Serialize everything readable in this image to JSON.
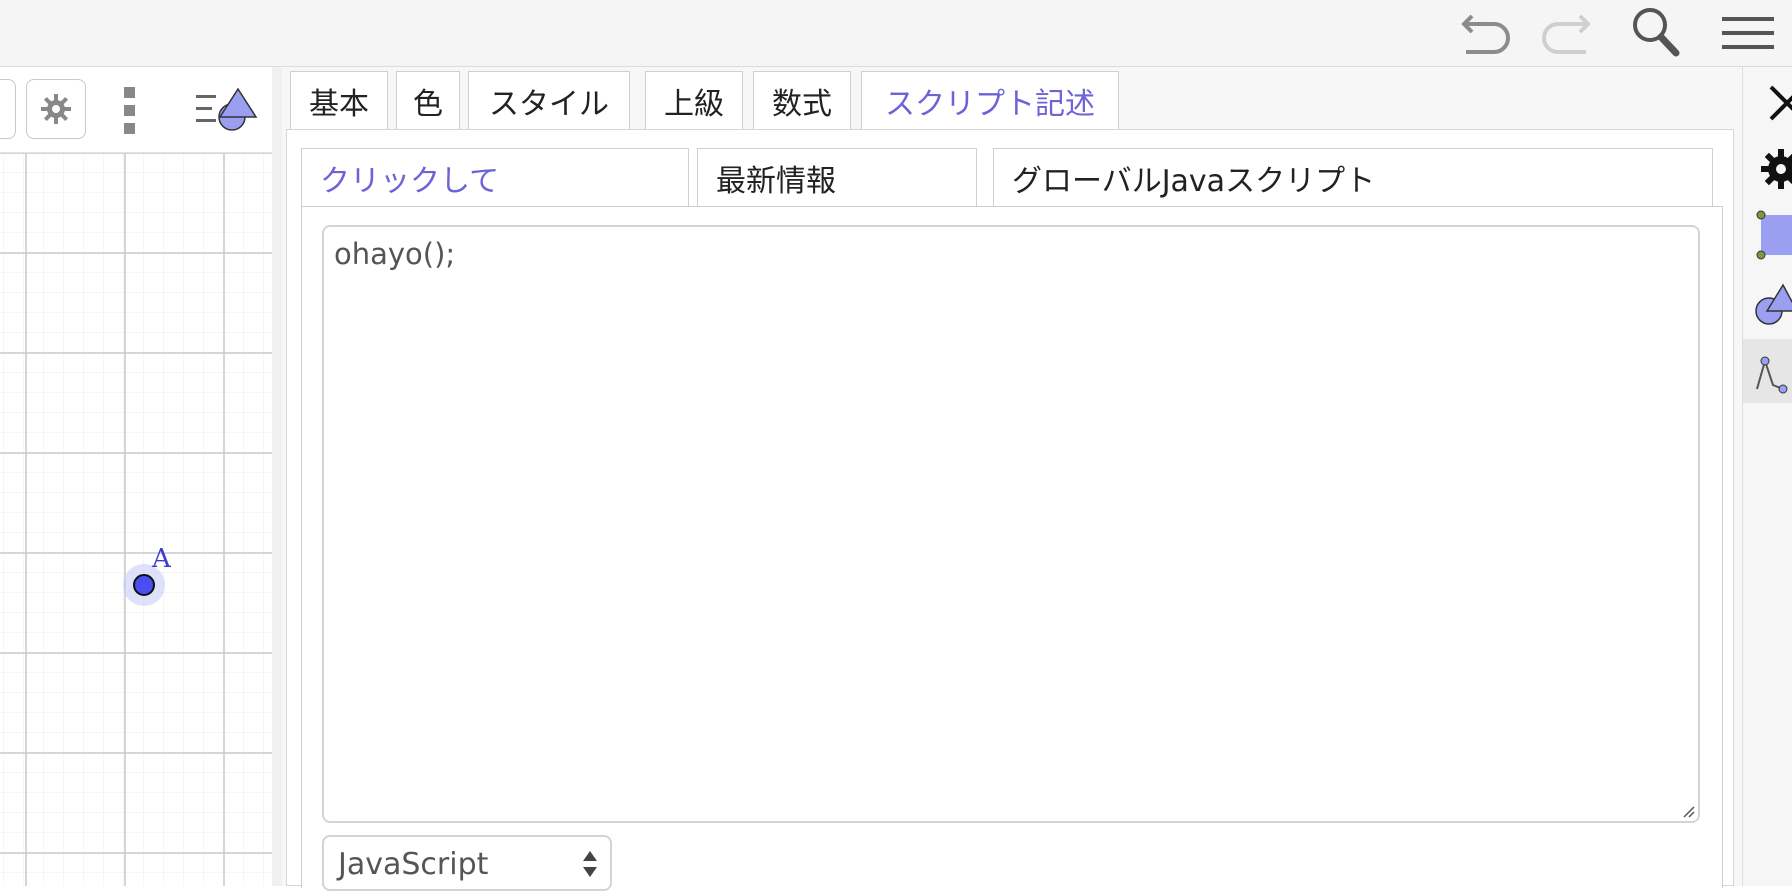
{
  "toolbar": {
    "icons": [
      "undo-icon",
      "redo-icon",
      "search-icon",
      "menu-icon"
    ]
  },
  "graphics_view": {
    "toolbar_icons": [
      "lock-icon",
      "gear-icon",
      "more-vertical-icon",
      "algebra-view-toggle-icon"
    ],
    "point_label": "A",
    "point_color": "#4a4ef0"
  },
  "properties": {
    "tabs": [
      {
        "label": "基本"
      },
      {
        "label": "色"
      },
      {
        "label": "スタイル"
      },
      {
        "label": "上級"
      },
      {
        "label": "数式"
      },
      {
        "label": "スクリプト記述",
        "active": true
      }
    ],
    "script_tabs": [
      {
        "label": "クリックして",
        "active": true
      },
      {
        "label": "最新情報"
      },
      {
        "label": "グローバルJavaスクリプト"
      }
    ],
    "script_text": "ohayo();",
    "language_select": {
      "selected": "JavaScript"
    }
  },
  "side_panel": {
    "icons": [
      "close-icon",
      "settings-icon",
      "polygon-style-icon",
      "shapes-icon",
      "function-icon"
    ]
  },
  "colors": {
    "accent": "#6b63d6",
    "point_fill": "#4a4ef0",
    "shape_fill": "#9b9ff2"
  }
}
